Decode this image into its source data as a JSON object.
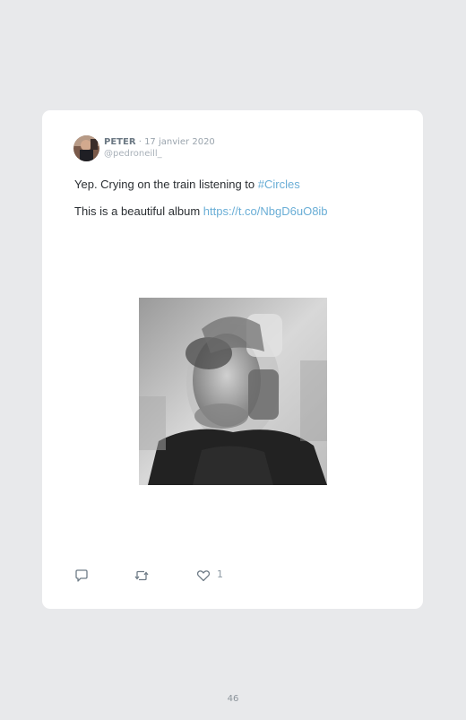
{
  "tweet": {
    "author": "PETER",
    "separator": " · ",
    "date": "17 janvier 2020",
    "handle": "@pedroneill_",
    "line1_text": "Yep. Crying on the train listening to ",
    "line1_hashtag": "#Circles",
    "line2_text": "This is a beautiful album ",
    "line2_link": "https://t.co/NbgD6uO8ib",
    "like_count": "1"
  },
  "icons": {
    "reply": "reply-icon",
    "retweet": "retweet-icon",
    "like": "heart-icon"
  },
  "colors": {
    "link": "#6aaed6",
    "background": "#e8e9eb",
    "card": "#ffffff"
  },
  "page": {
    "number": "46"
  }
}
